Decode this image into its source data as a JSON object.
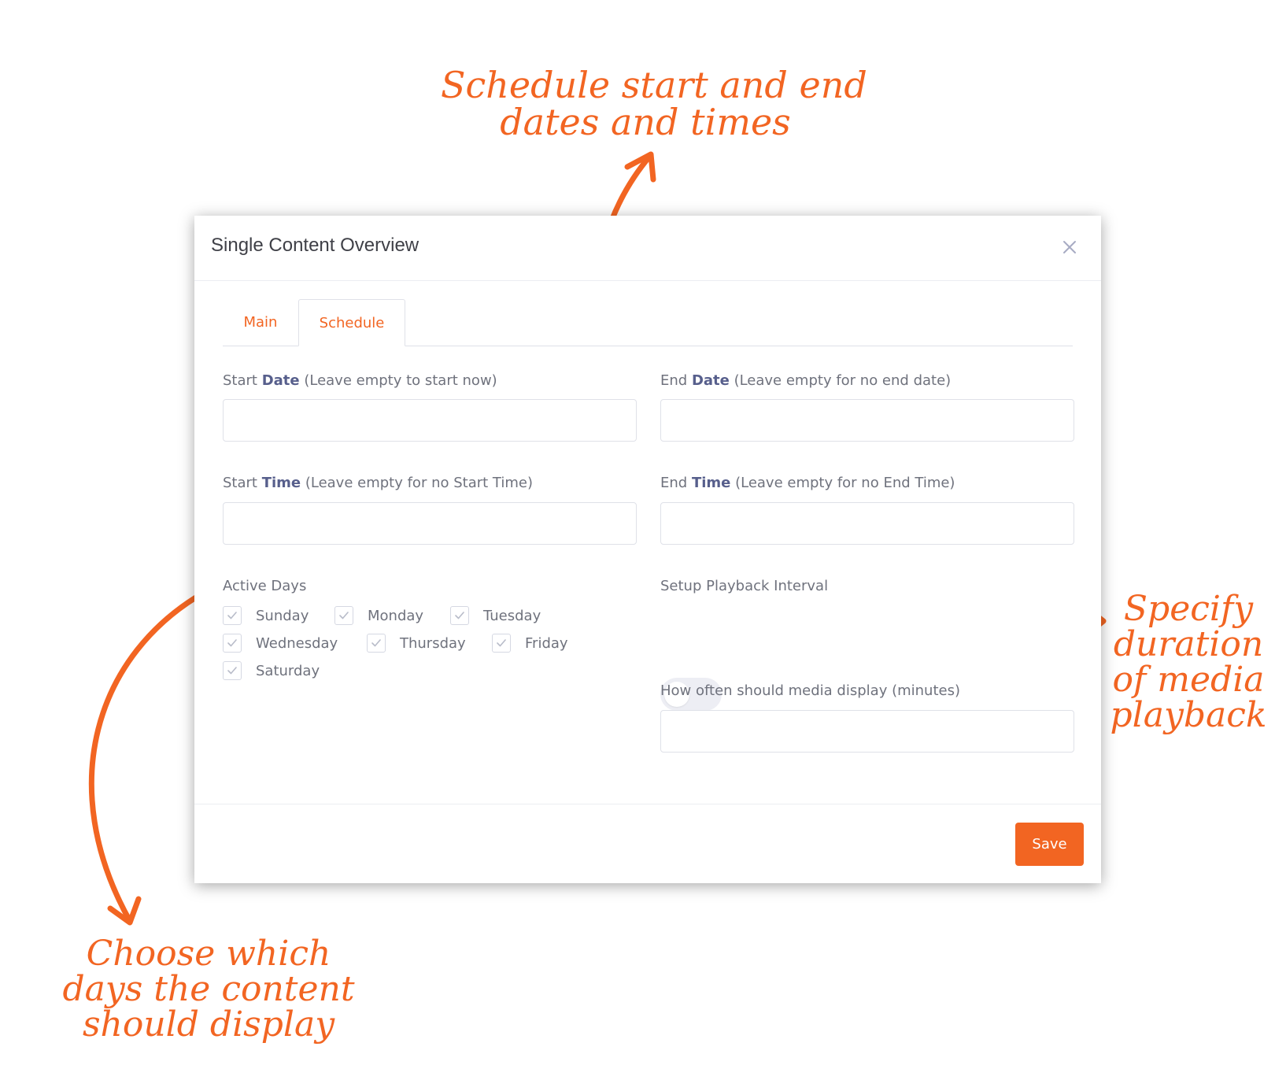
{
  "annotations": {
    "top": [
      "Schedule start and end",
      "dates and times"
    ],
    "right": [
      "Specify",
      "duration",
      "of media",
      "playback"
    ],
    "bottom": [
      "Choose which",
      "days the content",
      "should display"
    ],
    "color": "#f26522"
  },
  "modal": {
    "title": "Single Content Overview",
    "close_icon": "close-icon",
    "tabs": [
      {
        "label": "Main",
        "active": false
      },
      {
        "label": "Schedule",
        "active": true
      }
    ],
    "start_date": {
      "prefix": "Start ",
      "bold": "Date",
      "suffix": " (Leave empty to start now)",
      "value": ""
    },
    "end_date": {
      "prefix": "End ",
      "bold": "Date",
      "suffix": " (Leave empty for no end date)",
      "value": ""
    },
    "start_time": {
      "prefix": "Start ",
      "bold": "Time",
      "suffix": " (Leave empty for no Start Time)",
      "value": ""
    },
    "end_time": {
      "prefix": "End ",
      "bold": "Time",
      "suffix": " (Leave empty for no End Time)",
      "value": ""
    },
    "active_days": {
      "label": "Active Days",
      "days": [
        {
          "label": "Sunday",
          "checked": true
        },
        {
          "label": "Monday",
          "checked": true
        },
        {
          "label": "Tuesday",
          "checked": true
        },
        {
          "label": "Wednesday",
          "checked": true
        },
        {
          "label": "Thursday",
          "checked": true
        },
        {
          "label": "Friday",
          "checked": true
        },
        {
          "label": "Saturday",
          "checked": true
        }
      ]
    },
    "playback_interval": {
      "label": "Setup Playback Interval",
      "enabled": false
    },
    "display_frequency": {
      "label": "How often should media display (minutes)",
      "value": ""
    },
    "save_label": "Save",
    "accent_color": "#f26522"
  }
}
